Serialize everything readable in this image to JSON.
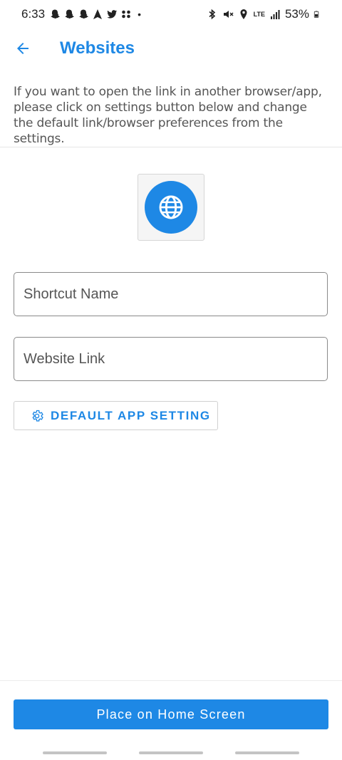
{
  "status_bar": {
    "time": "6:33",
    "battery": "53%",
    "network": "LTE",
    "left_icons": [
      "snapchat-icon",
      "snapchat-icon",
      "snapchat-icon",
      "navigation-icon",
      "twitter-icon",
      "pinwheel-icon"
    ],
    "right_icons": [
      "bluetooth-icon",
      "mute-icon",
      "location-icon",
      "lte-icon",
      "signal-icon",
      "battery-icon"
    ]
  },
  "app_bar": {
    "title": "Websites",
    "back_icon": "arrow-left-icon"
  },
  "info_text": "If you want to open the link in another browser/app, please click on settings button below and change the default link/browser preferences from the settings.",
  "icon_tile": {
    "icon": "globe-icon"
  },
  "form": {
    "shortcut_name": {
      "placeholder": "Shortcut Name",
      "value": ""
    },
    "website_link": {
      "placeholder": "Website Link",
      "value": ""
    }
  },
  "settings_button": {
    "label": "DEFAULT APP SETTING",
    "icon": "gear-icon"
  },
  "primary_button": {
    "label": "Place on Home Screen"
  },
  "colors": {
    "accent": "#1e88e5",
    "text": "#555555",
    "border": "#8a8a8a"
  }
}
